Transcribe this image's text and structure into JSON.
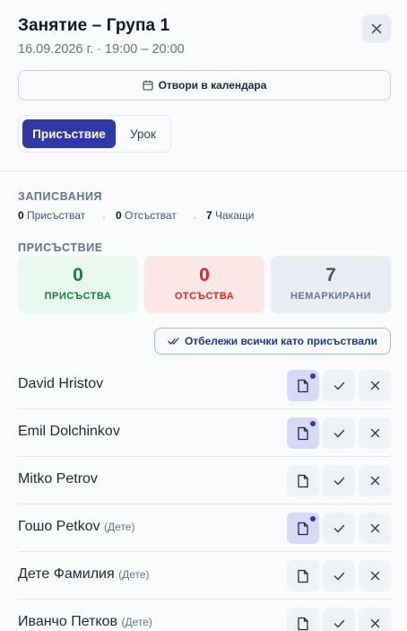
{
  "header": {
    "title": "Занятие – Група 1",
    "subtitle": "16.09.2026 г. · 19:00 – 20:00",
    "close_icon": "close-icon"
  },
  "calendar_button": {
    "label": "Отвори в календара",
    "icon": "calendar-icon"
  },
  "tabs": [
    {
      "label": "Присъствие",
      "active": true
    },
    {
      "label": "Урок",
      "active": false
    }
  ],
  "enrollments": {
    "heading": "ЗАПИСВАНИЯ",
    "present": {
      "count": "0",
      "label": "Присъстват"
    },
    "absent": {
      "count": "0",
      "label": "Отсъстват"
    },
    "waiting": {
      "count": "7",
      "label": "Чакащи"
    },
    "separator": "·"
  },
  "attendance": {
    "heading": "ПРИСЪСТВИЕ",
    "present": {
      "value": "0",
      "label": "ПРИСЪСТВА"
    },
    "absent": {
      "value": "0",
      "label": "ОТСЪСТВА"
    },
    "unmarked": {
      "value": "7",
      "label": "НЕМАРКИРАНИ"
    }
  },
  "mark_all_button": {
    "label": "Отбележи всички като присъствали",
    "icon": "double-check-icon"
  },
  "students": [
    {
      "name": "David Hristov",
      "tag": "",
      "has_note": true
    },
    {
      "name": "Emil Dolchinkov",
      "tag": "",
      "has_note": true
    },
    {
      "name": "Mitko Petrov",
      "tag": "",
      "has_note": false
    },
    {
      "name": "Гошо Petkov",
      "tag": "(Дете)",
      "has_note": true
    },
    {
      "name": "Дете Фамилия",
      "tag": "(Дете)",
      "has_note": false
    },
    {
      "name": "Иванчо Петков",
      "tag": "(Дете)",
      "has_note": false
    }
  ],
  "colors": {
    "primary": "#3237a8",
    "present": "#15803d",
    "absent": "#dc2626",
    "muted": "#64748b"
  }
}
